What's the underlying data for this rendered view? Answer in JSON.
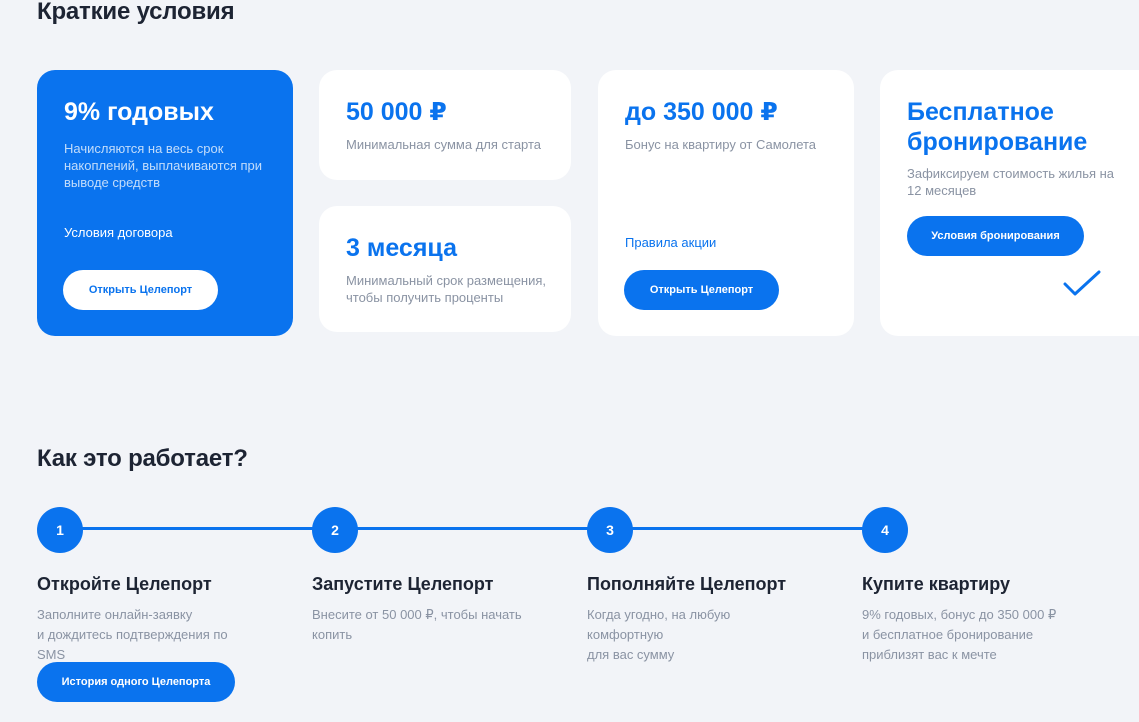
{
  "summary": {
    "title": "Краткие условия",
    "card_rate": {
      "value": "9% годовых",
      "description": "Начисляются на весь срок накоплений, выплачиваются при выводе средств",
      "link": "Условия договора",
      "button": "Открыть Целепорт"
    },
    "card_min_sum": {
      "value": "50 000 ₽",
      "description": "Минимальная сумма для старта"
    },
    "card_term": {
      "value": "3 месяца",
      "description": "Минимальный срок размещения, чтобы получить проценты"
    },
    "card_bonus": {
      "value": "до 350 000 ₽",
      "description": "Бонус на квартиру от Самолета",
      "link": "Правила акции",
      "button": "Открыть Целепорт"
    },
    "card_booking": {
      "value": "Бесплатное бронирование",
      "description": "Зафиксируем стоимость жилья на 12 месяцев",
      "button": "Условия бронирования",
      "icon": "checkmark-icon"
    }
  },
  "how": {
    "title": "Как это работает?",
    "steps": [
      {
        "number": "1",
        "title": "Откройте Целепорт",
        "text": "Заполните онлайн-заявку\nи дождитесь подтверждения по SMS"
      },
      {
        "number": "2",
        "title": "Запустите Целепорт",
        "text": "Внесите от 50 000 ₽, чтобы начать\nкопить"
      },
      {
        "number": "3",
        "title": "Пополняйте Целепорт",
        "text": "Когда угодно, на любую комфортную\nдля вас сумму"
      },
      {
        "number": "4",
        "title": "Купите квартиру",
        "text": "9% годовых, бонус до 350 000 ₽\nи бесплатное бронирование\nприблизят вас к мечте"
      }
    ],
    "history_button": "История одного Целепорта"
  },
  "colors": {
    "accent": "#0a73ee",
    "background": "#f2f4f8",
    "text": "#1d2433",
    "muted": "#8a93a3"
  }
}
